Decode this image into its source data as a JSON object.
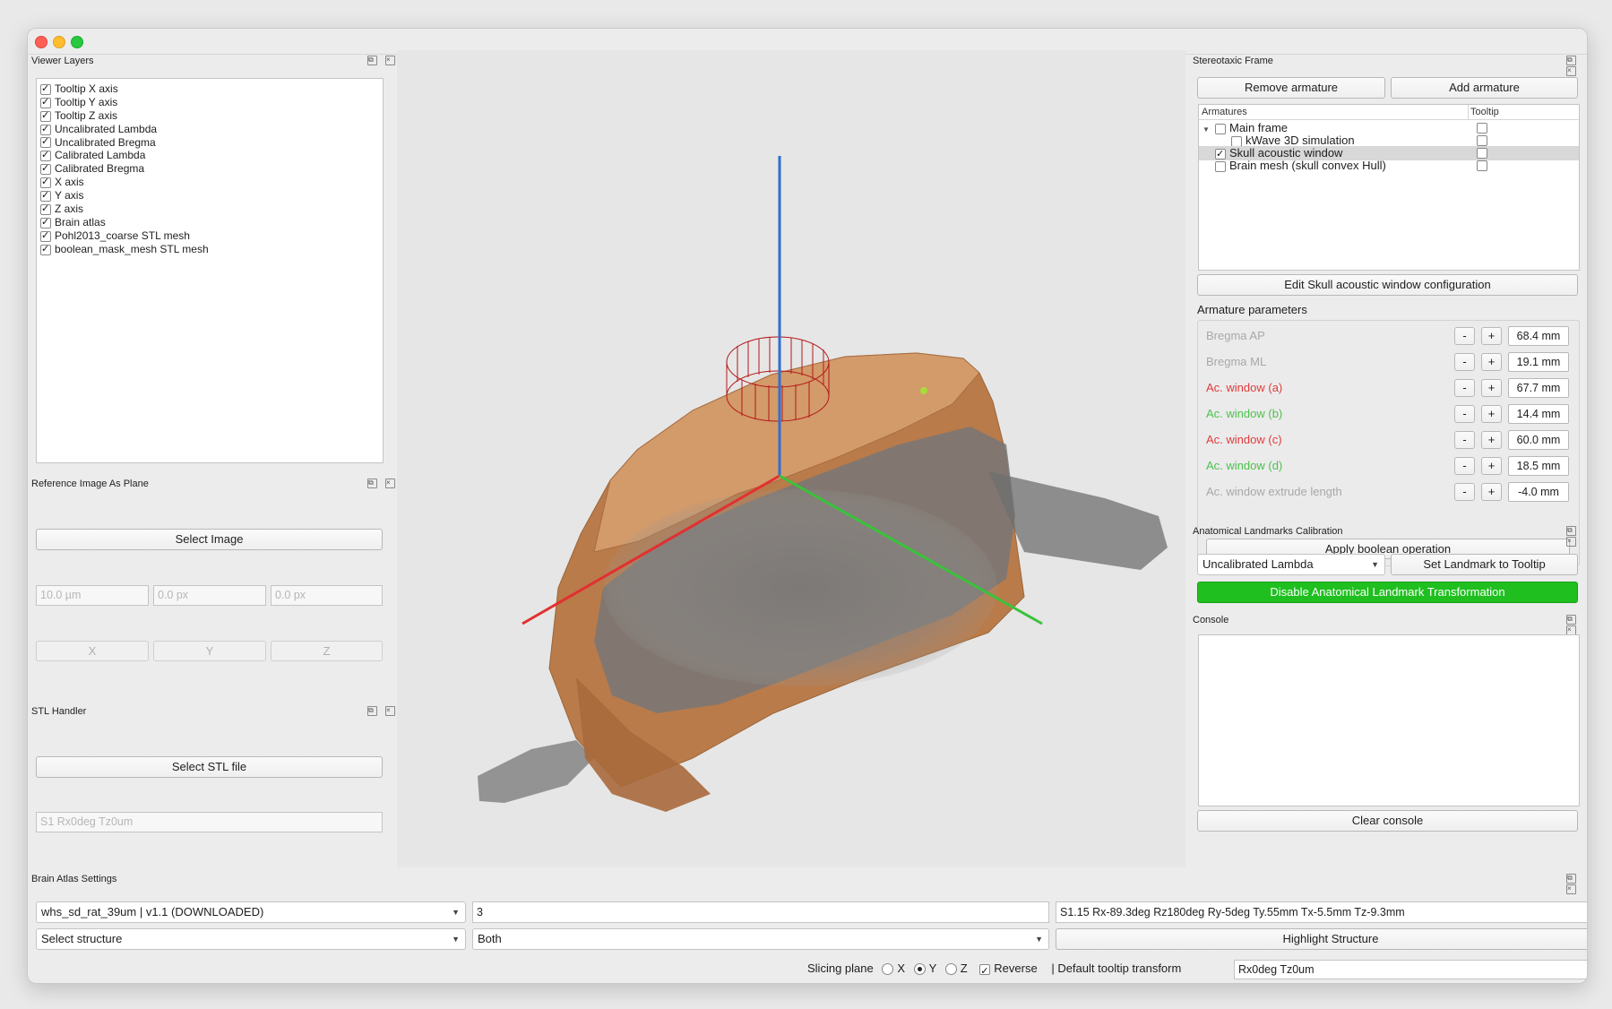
{
  "viewer_layers": {
    "title": "Viewer Layers",
    "items": [
      {
        "label": "Tooltip X axis",
        "checked": true
      },
      {
        "label": "Tooltip Y axis",
        "checked": true
      },
      {
        "label": "Tooltip Z axis",
        "checked": true
      },
      {
        "label": "Uncalibrated Lambda",
        "checked": true
      },
      {
        "label": "Uncalibrated Bregma",
        "checked": true
      },
      {
        "label": "Calibrated Lambda",
        "checked": true
      },
      {
        "label": "Calibrated Bregma",
        "checked": true
      },
      {
        "label": "X axis",
        "checked": true
      },
      {
        "label": "Y axis",
        "checked": true
      },
      {
        "label": "Z axis",
        "checked": true
      },
      {
        "label": "Brain atlas",
        "checked": true
      },
      {
        "label": "Pohl2013_coarse STL mesh",
        "checked": true
      },
      {
        "label": "boolean_mask_mesh STL mesh",
        "checked": true
      }
    ]
  },
  "reference_image": {
    "title": "Reference Image As Plane",
    "select_label": "Select Image",
    "fields": [
      "10.0 µm",
      "0.0 px",
      "0.0 px"
    ],
    "axis_buttons": [
      "X",
      "Y",
      "Z"
    ]
  },
  "stl_handler": {
    "title": "STL Handler",
    "select_label": "Select STL file",
    "transform_placeholder": "S1 Rx0deg Tz0um"
  },
  "stereotaxic": {
    "title": "Stereotaxic Frame",
    "remove_label": "Remove armature",
    "add_label": "Add armature",
    "col_armatures": "Armatures",
    "col_tooltip": "Tooltip",
    "rows": [
      {
        "label": "Main frame",
        "checked": false,
        "expanded": true,
        "indent": 0,
        "selected": false
      },
      {
        "label": "kWave 3D simulation",
        "checked": false,
        "indent": 1,
        "selected": false
      },
      {
        "label": "Skull acoustic window",
        "checked": true,
        "indent": 0,
        "selected": true
      },
      {
        "label": "Brain mesh (skull convex Hull)",
        "checked": false,
        "indent": 0,
        "selected": false
      }
    ],
    "edit_label": "Edit Skull acoustic window configuration",
    "params_title": "Armature parameters",
    "params": [
      {
        "label": "Bregma AP",
        "value": "68.4 mm",
        "color": "#a8a8a8"
      },
      {
        "label": "Bregma ML",
        "value": "19.1 mm",
        "color": "#a8a8a8"
      },
      {
        "label": "Ac. window (a)",
        "value": "67.7 mm",
        "color": "#e23b3b"
      },
      {
        "label": "Ac. window (b)",
        "value": "14.4 mm",
        "color": "#4cc24c"
      },
      {
        "label": "Ac. window (c)",
        "value": "60.0 mm",
        "color": "#e23b3b"
      },
      {
        "label": "Ac. window (d)",
        "value": "18.5 mm",
        "color": "#4cc24c"
      },
      {
        "label": "Ac. window extrude length",
        "value": "-4.0 mm",
        "color": "#a8a8a8"
      }
    ],
    "minus": "-",
    "plus": "+",
    "apply_label": "Apply boolean operation"
  },
  "landmarks": {
    "title": "Anatomical Landmarks Calibration",
    "combo_value": "Uncalibrated Lambda",
    "set_label": "Set Landmark to Tooltip",
    "disable_label": "Disable Anatomical Landmark Transformation",
    "disable_color": "#1fbf1f"
  },
  "console": {
    "title": "Console",
    "clear_label": "Clear console"
  },
  "atlas": {
    "title": "Brain Atlas Settings",
    "atlas_combo": "whs_sd_rat_39um | v1.1 (DOWNLOADED)",
    "field2": "3",
    "transform": "S1.15 Rx-89.3deg Rz180deg Ry-5deg Ty.55mm Tx-5.5mm Tz-9.3mm",
    "structure_combo": "Select structure",
    "hemisphere_combo": "Both",
    "highlight_label": "Highlight Structure"
  },
  "statusbar": {
    "slicing_label": "Slicing plane",
    "x": "X",
    "y": "Y",
    "z": "Z",
    "selected_plane": "Y",
    "reverse_label": "Reverse",
    "reverse_checked": true,
    "default_label": "| Default tooltip transform",
    "default_value": "Rx0deg Tz0um"
  },
  "viewport_axes": {
    "x_color": "#e23030",
    "y_color": "#3ac23a",
    "z_color": "#2f6fd0",
    "mesh_color": "#c58855"
  }
}
